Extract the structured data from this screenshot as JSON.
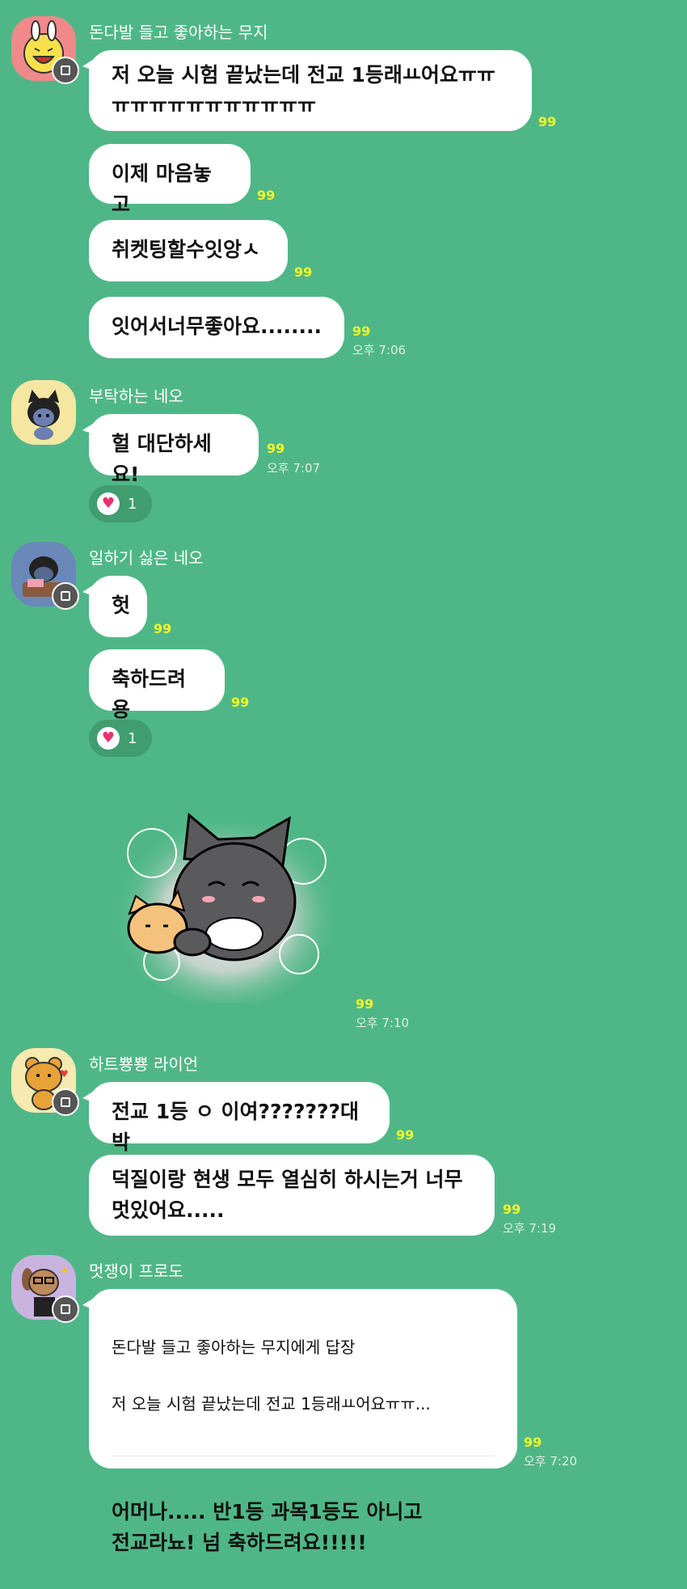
{
  "colors": {
    "background": "#4fb787",
    "bubble": "#ffffff",
    "read_count": "#f5f529",
    "reaction_bg": "#3f9d70",
    "heart": "#e8326b"
  },
  "groups": [
    {
      "sender": "돈다발 들고 좋아하는 무지",
      "messages": [
        {
          "text": "저 오늘 시험 끝났는데 전교 1등래ㅛ어요ㅠㅠ\nㅠㅠㅠㅠㅠㅠㅠㅠㅠㅠㅠ",
          "read": "99"
        },
        {
          "text": "이제 마음놓고",
          "read": "99"
        },
        {
          "text": "취켓팅할수잇앙ㅅ",
          "read": "99"
        },
        {
          "text": "잇어서너무좋아요........",
          "read": "99",
          "time": "오후 7:06"
        }
      ]
    },
    {
      "sender": "부탁하는 네오",
      "messages": [
        {
          "text": "헐 대단하세요!",
          "read": "99",
          "time": "오후 7:07",
          "reaction": {
            "icon": "heart",
            "count": "1"
          }
        }
      ]
    },
    {
      "sender": "일하기 싫은 네오",
      "messages": [
        {
          "text": "헛",
          "read": "99"
        },
        {
          "text": "축하드려용",
          "read": "99",
          "reaction": {
            "icon": "heart",
            "count": "1"
          }
        },
        {
          "sticker": "cat-hugging-kitten-emoticon",
          "read": "99",
          "time": "오후 7:10"
        }
      ]
    },
    {
      "sender": "하트뿅뿅 라이언",
      "messages": [
        {
          "text": "전교 1등 ㅇ 이여???????대박",
          "read": "99"
        },
        {
          "text": "덕질이랑 현생 모두 열심히 하시는거 너무\n멋있어요.....",
          "read": "99",
          "time": "오후 7:19"
        }
      ]
    },
    {
      "sender": "멋쟁이 프로도",
      "messages": [
        {
          "reply_to": "돈다발 들고 좋아하는 무지에게 답장",
          "reply_quote": "저 오늘 시험 끝났는데 전교 1등래ㅛ어요ㅠㅠ...",
          "text": "어머나..... 반1등 과목1등도 아니고\n전교라뇨! 넘 축하드려요!!!!!",
          "read": "99",
          "time": "오후 7:20"
        }
      ]
    }
  ]
}
